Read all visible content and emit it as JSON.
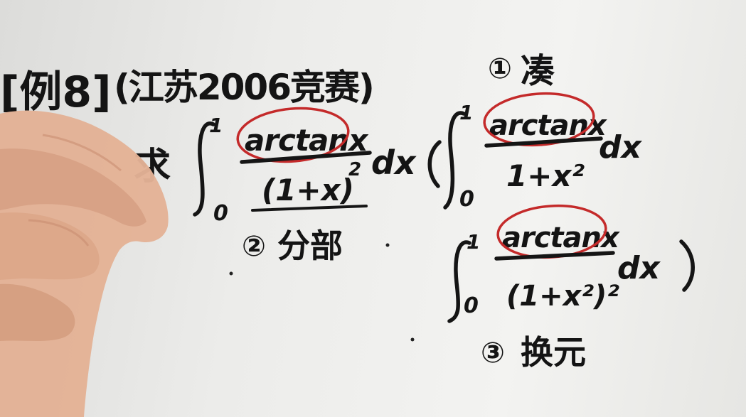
{
  "title": {
    "label": "[例8]",
    "source": "(江苏2006竞赛)"
  },
  "problem": {
    "verb": "求",
    "lower_limit": "0",
    "upper_limit": "1",
    "numerator": "arctanx",
    "denominator_base": "(1+x)",
    "denominator_exp": "2",
    "dx": "dx"
  },
  "methods": [
    {
      "number": "①",
      "name": "凑"
    },
    {
      "number": "②",
      "name": "分部"
    },
    {
      "number": "③",
      "name": "换元"
    }
  ],
  "aside_integrals": [
    {
      "lower_limit": "0",
      "upper_limit": "1",
      "numerator": "arctanx",
      "denominator": "1+x²",
      "dx": "dx"
    },
    {
      "lower_limit": "0",
      "upper_limit": "1",
      "numerator": "arctanx",
      "denominator": "(1+x²)²",
      "dx": "dx"
    }
  ],
  "colors": {
    "ink": "#151515",
    "circle": "#c42a2a",
    "paper": "#efefed",
    "hand": "#e7b79a"
  }
}
